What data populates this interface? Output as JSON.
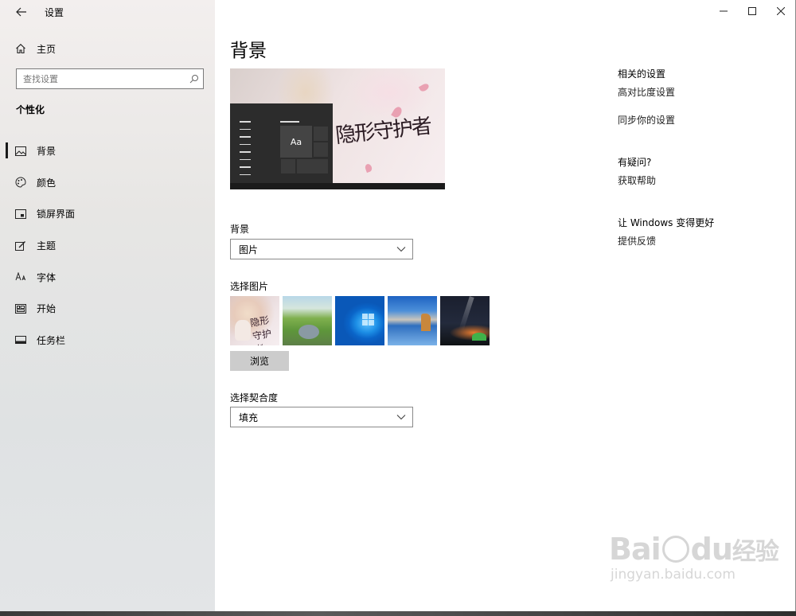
{
  "window": {
    "title": "设置",
    "controls": {
      "minimize": "—",
      "maximize": "☐",
      "close": "✕"
    }
  },
  "sidebar": {
    "home_label": "主页",
    "search_placeholder": "查找设置",
    "section_title": "个性化",
    "items": [
      {
        "label": "背景",
        "icon": "picture-icon",
        "active": true
      },
      {
        "label": "颜色",
        "icon": "palette-icon",
        "active": false
      },
      {
        "label": "锁屏界面",
        "icon": "lock-screen-icon",
        "active": false
      },
      {
        "label": "主题",
        "icon": "theme-brush-icon",
        "active": false
      },
      {
        "label": "字体",
        "icon": "font-icon",
        "active": false
      },
      {
        "label": "开始",
        "icon": "start-menu-icon",
        "active": false
      },
      {
        "label": "任务栏",
        "icon": "taskbar-icon",
        "active": false
      }
    ]
  },
  "main": {
    "page_title": "背景",
    "preview": {
      "tile_text": "Aa",
      "artwork_text": "隐形守护者"
    },
    "background": {
      "label": "背景",
      "selected": "图片"
    },
    "choose_picture": {
      "label": "选择图片",
      "thumbnails": [
        "game-art-thumbnail",
        "green-hills-thumbnail",
        "windows-blue-thumbnail",
        "beach-rock-thumbnail",
        "night-sky-tent-thumbnail"
      ]
    },
    "browse_label": "浏览",
    "fit": {
      "label": "选择契合度",
      "selected": "填充"
    }
  },
  "right_panel": {
    "related_heading": "相关的设置",
    "related_links": [
      "高对比度设置",
      "同步你的设置"
    ],
    "question_heading": "有疑问?",
    "question_link": "获取帮助",
    "feedback_heading": "让 Windows 变得更好",
    "feedback_link": "提供反馈"
  },
  "watermark": {
    "line1_a": "Bai",
    "line1_b": "du",
    "line1_c": "经验",
    "line2": "jingyan.baidu.com"
  }
}
